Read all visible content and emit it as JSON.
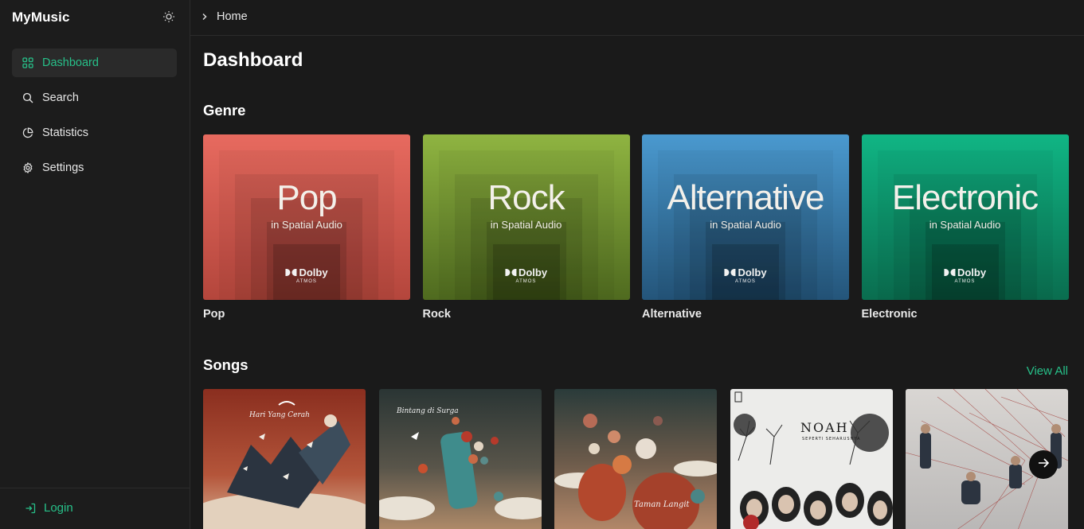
{
  "app": {
    "brand": "MyMusic"
  },
  "sidebar": {
    "items": [
      {
        "label": "Dashboard",
        "icon": "grid-icon",
        "active": true
      },
      {
        "label": "Search",
        "icon": "search-icon",
        "active": false
      },
      {
        "label": "Statistics",
        "icon": "pie-chart-icon",
        "active": false
      },
      {
        "label": "Settings",
        "icon": "gear-icon",
        "active": false
      }
    ],
    "login_label": "Login"
  },
  "breadcrumb": {
    "current": "Home"
  },
  "page": {
    "title": "Dashboard"
  },
  "genre": {
    "title": "Genre",
    "cards": [
      {
        "art_title": "Pop",
        "art_subtitle": "in Spatial Audio",
        "brand": "Dolby",
        "brand_sub": "ATMOS",
        "label": "Pop",
        "color_top": "#e76a5f",
        "color_bottom": "#b4463c"
      },
      {
        "art_title": "Rock",
        "art_subtitle": "in Spatial Audio",
        "brand": "Dolby",
        "brand_sub": "ATMOS",
        "label": "Rock",
        "color_top": "#8fb441",
        "color_bottom": "#4f6a1f"
      },
      {
        "art_title": "Alternative",
        "art_subtitle": "in Spatial Audio",
        "brand": "Dolby",
        "brand_sub": "ATMOS",
        "label": "Alternative",
        "color_top": "#4a99cf",
        "color_bottom": "#24557a"
      },
      {
        "art_title": "Electronic",
        "art_subtitle": "in Spatial Audio",
        "brand": "Dolby",
        "brand_sub": "ATMOS",
        "label": "Electronic",
        "color_top": "#10b584",
        "color_bottom": "#0a6d4f"
      }
    ]
  },
  "songs": {
    "title": "Songs",
    "view_all_label": "View All",
    "covers": [
      {
        "name": "song-cover-hari-yang-cerah",
        "script_text": "Hari Yang Cerah"
      },
      {
        "name": "song-cover-bintang-di-surga",
        "script_text": "Bintang di Surga"
      },
      {
        "name": "song-cover-taman-langit",
        "script_text": "Taman Langit"
      },
      {
        "name": "song-cover-noah",
        "band": "NOAH",
        "album": "SEPERTI SEHARUSNYA"
      },
      {
        "name": "song-cover-band-photo",
        "script_text": ""
      }
    ]
  },
  "colors": {
    "accent": "#27c089",
    "background": "#1a1a1a",
    "sidebar_active": "#2a2a2a"
  }
}
